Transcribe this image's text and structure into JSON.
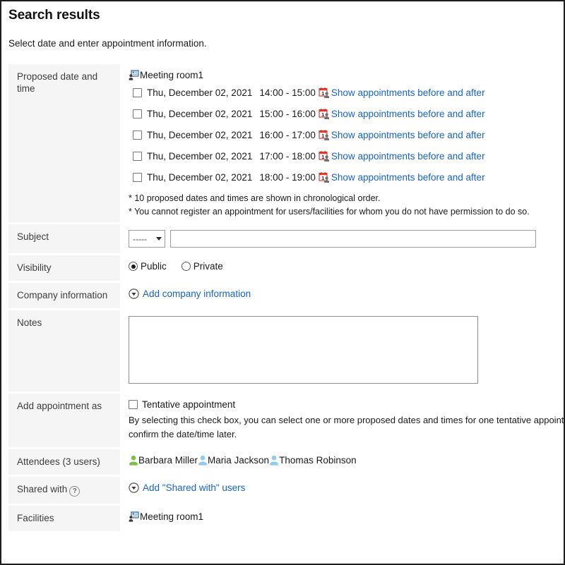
{
  "page": {
    "title": "Search results",
    "description": "Select date and enter appointment information."
  },
  "colors": {
    "link": "#1563c6",
    "label_bg": "#f5f5f5",
    "organizer_icon": "#7ac143",
    "attendee_icon": "#8ecbef",
    "calendar_icon": "#e8392e",
    "facility_icon": "#2f6fba"
  },
  "rows": {
    "proposed": {
      "label": "Proposed date and time",
      "facility": "Meeting room1",
      "slots": [
        {
          "date": "Thu, December 02, 2021",
          "time": "14:00 -  15:00",
          "link": "Show appointments before and after",
          "checked": false
        },
        {
          "date": "Thu, December 02, 2021",
          "time": "15:00 -  16:00",
          "link": "Show appointments before and after",
          "checked": false
        },
        {
          "date": "Thu, December 02, 2021",
          "time": "16:00 -  17:00",
          "link": "Show appointments before and after",
          "checked": false
        },
        {
          "date": "Thu, December 02, 2021",
          "time": "17:00 -  18:00",
          "link": "Show appointments before and after",
          "checked": false
        },
        {
          "date": "Thu, December 02, 2021",
          "time": "18:00 -  19:00",
          "link": "Show appointments before and after",
          "checked": false
        }
      ],
      "note1": "* 10 proposed dates and times are shown in chronological order.",
      "note2": "* You cannot register an appointment for users/facilities for whom you do not have permission to do so."
    },
    "subject": {
      "label": "Subject",
      "select_value": "-----",
      "input_value": "",
      "input_placeholder": ""
    },
    "visibility": {
      "label": "Visibility",
      "options": [
        {
          "label": "Public",
          "selected": true
        },
        {
          "label": "Private",
          "selected": false
        }
      ]
    },
    "company": {
      "label": "Company information",
      "add_link": "Add company information"
    },
    "notes": {
      "label": "Notes",
      "value": "",
      "placeholder": ""
    },
    "appointment_as": {
      "label": "Add appointment as",
      "checkbox_label": "Tentative appointment",
      "checked": false,
      "description": "By selecting this check box, you can select one or more proposed dates and times for one tentative appointment. You can confirm the date/time later."
    },
    "attendees": {
      "label": "Attendees (3 users)",
      "users": [
        {
          "name": "Barbara Miller",
          "role": "organizer"
        },
        {
          "name": "Maria Jackson",
          "role": "attendee"
        },
        {
          "name": "Thomas Robinson",
          "role": "attendee"
        }
      ]
    },
    "shared_with": {
      "label": "Shared with",
      "help": "?",
      "add_link": "Add \"Shared with\" users"
    },
    "facilities": {
      "label": "Facilities",
      "value": "Meeting room1"
    }
  }
}
